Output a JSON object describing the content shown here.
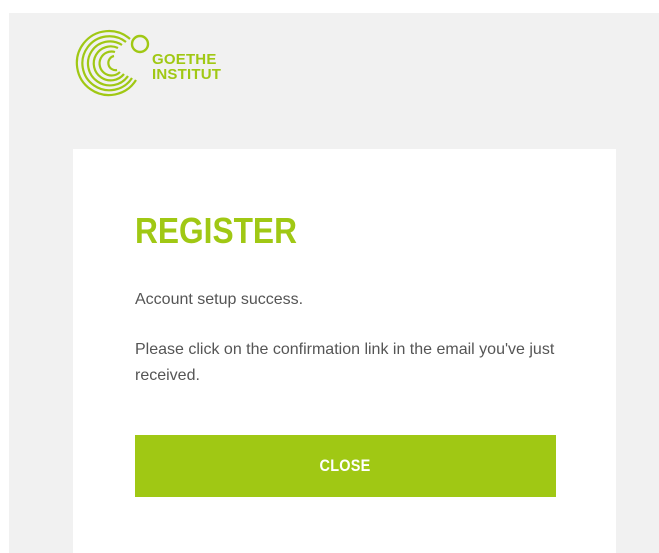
{
  "brand": {
    "name_line1": "GOETHE",
    "name_line2": "INSTITUT",
    "color": "#a0c814",
    "icon": "goethe-circles-logo"
  },
  "dialog": {
    "title": "REGISTER",
    "message_success": "Account setup success.",
    "message_instruction": "Please click on the confirmation link in the email you've just received.",
    "close_label": "CLOSE"
  },
  "colors": {
    "accent": "#a0c814",
    "text": "#555555",
    "page_background": "#f1f1f1",
    "card_background": "#ffffff"
  }
}
